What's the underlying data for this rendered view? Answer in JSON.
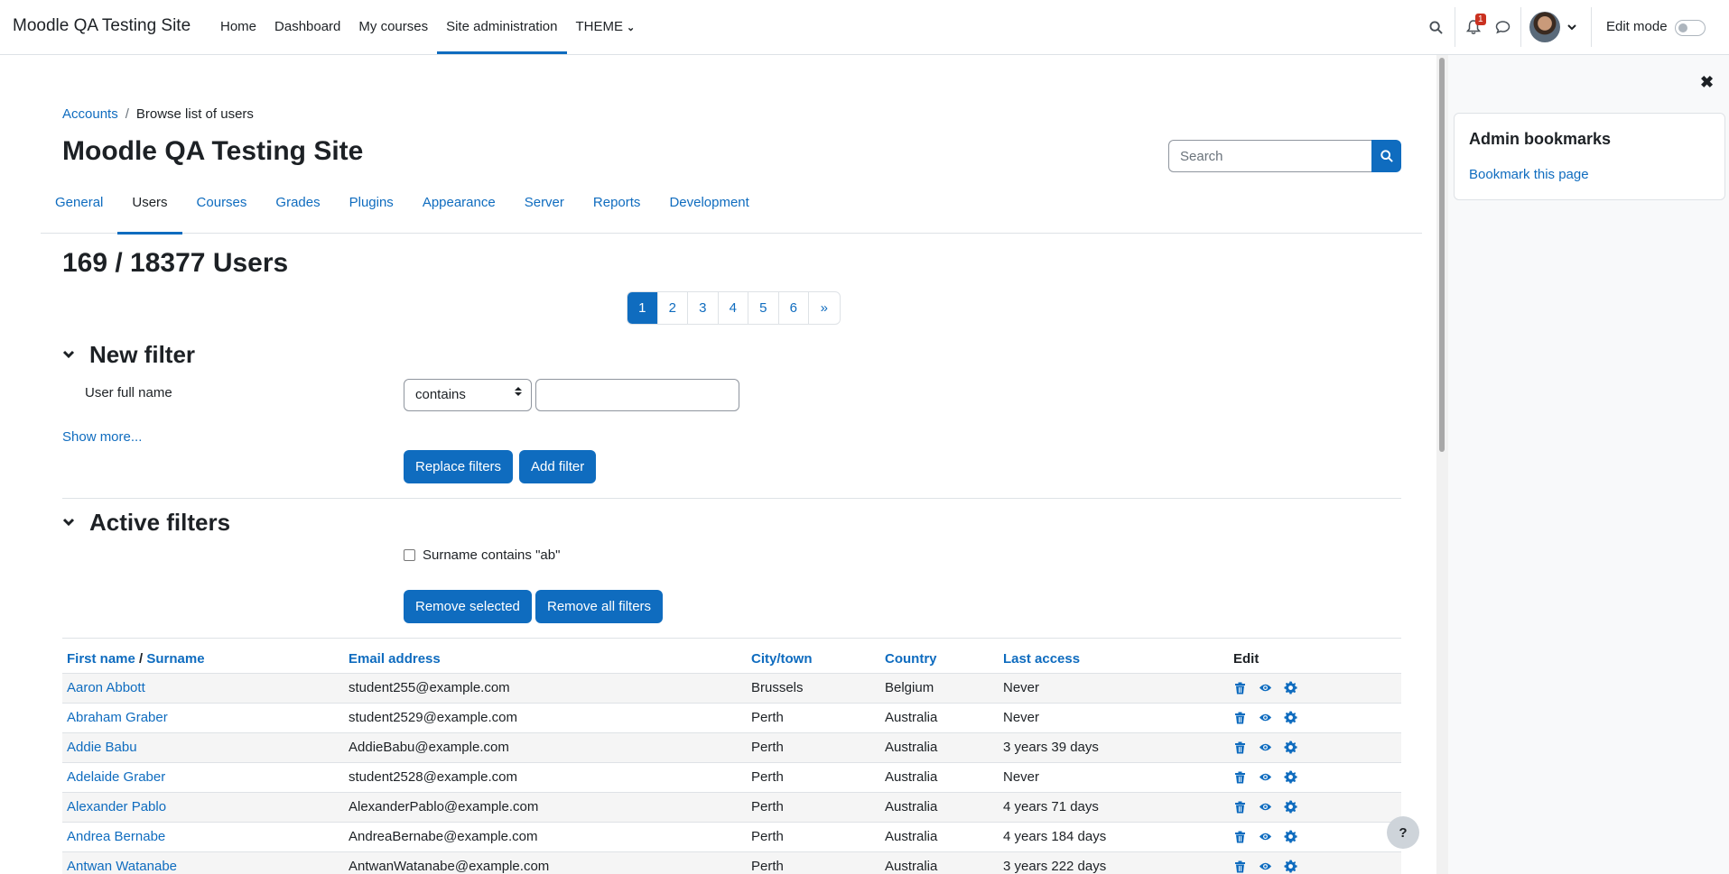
{
  "navbar": {
    "brand": "Moodle QA Testing Site",
    "items": [
      {
        "label": "Home"
      },
      {
        "label": "Dashboard"
      },
      {
        "label": "My courses"
      },
      {
        "label": "Site administration"
      },
      {
        "label": "THEME"
      }
    ],
    "notification_count": "1",
    "edit_mode_label": "Edit mode"
  },
  "breadcrumb": [
    "Accounts",
    "Browse list of users"
  ],
  "page_title": "Moodle QA Testing Site",
  "search": {
    "placeholder": "Search"
  },
  "tabs": [
    "General",
    "Users",
    "Courses",
    "Grades",
    "Plugins",
    "Appearance",
    "Server",
    "Reports",
    "Development"
  ],
  "users_heading": "169 / 18377 Users",
  "pagination": [
    "1",
    "2",
    "3",
    "4",
    "5",
    "6",
    "»"
  ],
  "new_filter": {
    "heading": "New filter",
    "field_label": "User full name",
    "operator": "contains",
    "value": "",
    "show_more": "Show more...",
    "replace_button": "Replace filters",
    "add_button": "Add filter"
  },
  "active_filters": {
    "heading": "Active filters",
    "filter_text": "Surname contains \"ab\"",
    "remove_selected": "Remove selected",
    "remove_all": "Remove all filters"
  },
  "table": {
    "headers": {
      "first_name": "First name",
      "slash": "/",
      "surname": "Surname",
      "email": "Email address",
      "city": "City/town",
      "country": "Country",
      "last_access": "Last access",
      "edit": "Edit"
    },
    "rows": [
      {
        "name": "Aaron Abbott",
        "email": "student255@example.com",
        "city": "Brussels",
        "country": "Belgium",
        "last_access": "Never"
      },
      {
        "name": "Abraham Graber",
        "email": "student2529@example.com",
        "city": "Perth",
        "country": "Australia",
        "last_access": "Never"
      },
      {
        "name": "Addie Babu",
        "email": "AddieBabu@example.com",
        "city": "Perth",
        "country": "Australia",
        "last_access": "3 years 39 days"
      },
      {
        "name": "Adelaide Graber",
        "email": "student2528@example.com",
        "city": "Perth",
        "country": "Australia",
        "last_access": "Never"
      },
      {
        "name": "Alexander Pablo",
        "email": "AlexanderPablo@example.com",
        "city": "Perth",
        "country": "Australia",
        "last_access": "4 years 71 days"
      },
      {
        "name": "Andrea Bernabe",
        "email": "AndreaBernabe@example.com",
        "city": "Perth",
        "country": "Australia",
        "last_access": "4 years 184 days"
      },
      {
        "name": "Antwan Watanabe",
        "email": "AntwanWatanabe@example.com",
        "city": "Perth",
        "country": "Australia",
        "last_access": "3 years 222 days"
      }
    ]
  },
  "drawer": {
    "close_glyph": "✖",
    "block_title": "Admin bookmarks",
    "block_link": "Bookmark this page"
  },
  "help_glyph": "?",
  "colors": {
    "accent": "#0f6cbf",
    "text": "#1d2125",
    "border": "#dee2e6",
    "badge": "#ca3120"
  }
}
